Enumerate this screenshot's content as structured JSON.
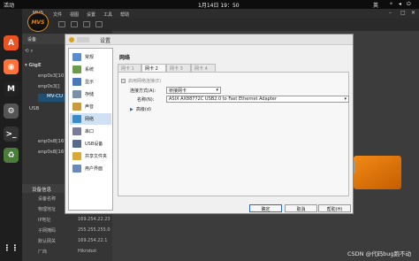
{
  "topbar": {
    "activities": "活动",
    "clock": "1月14日  19：50",
    "lang": "英",
    "tray": "⚬ ◂ ⏻"
  },
  "dock": [
    {
      "icon": "app-center-icon",
      "color": "#e95420",
      "glyph": "A"
    },
    {
      "icon": "firefox-icon",
      "color": "#ff7139",
      "glyph": "◉"
    },
    {
      "icon": "mvs-icon",
      "color": "#222222",
      "glyph": "M"
    },
    {
      "icon": "settings-icon",
      "color": "#555555",
      "glyph": "⚙"
    },
    {
      "icon": "terminal-icon",
      "color": "#333333",
      "glyph": ">_"
    },
    {
      "icon": "trash-icon",
      "color": "#4a7c3a",
      "glyph": "♻"
    },
    {
      "icon": "app-grid-icon",
      "color": "#1e1e1e",
      "glyph": "⋮⋮"
    }
  ],
  "mvs": {
    "window_title": "MVS",
    "logo": "MVS",
    "menu": [
      "文件",
      "视图",
      "设置",
      "工具",
      "帮助"
    ],
    "device_panel_header": "设备",
    "gige_label": "GigE",
    "enp0s3_1": "enp0s3[10.0",
    "enp0s3_2": "enp0s3[]",
    "device": "MV-CU",
    "usb_label": "USB",
    "enp0s8_1": "enp0s8[169",
    "enp0s8_2": "enp0s8[169",
    "devinfo_header": "设备信息",
    "devinfo": [
      {
        "k": "设备名称",
        "v": ""
      },
      {
        "k": "物理地址",
        "v": ""
      },
      {
        "k": "IP地址",
        "v": "169.254.22.23"
      },
      {
        "k": "子网掩码",
        "v": "255.255.255.0"
      },
      {
        "k": "默认网关",
        "v": "169.254.22.1"
      },
      {
        "k": "厂商",
        "v": "Hikrobot"
      }
    ]
  },
  "dialog": {
    "title": "设置",
    "categories": [
      {
        "label": "常规",
        "icon": "general-icon",
        "color": "#5a8bd0"
      },
      {
        "label": "系统",
        "icon": "system-icon",
        "color": "#6a9a4a"
      },
      {
        "label": "显示",
        "icon": "display-icon",
        "color": "#4a78b8"
      },
      {
        "label": "存储",
        "icon": "storage-icon",
        "color": "#7b8fa8"
      },
      {
        "label": "声音",
        "icon": "audio-icon",
        "color": "#c89a3a"
      },
      {
        "label": "网络",
        "icon": "network-icon",
        "color": "#3a8ac8"
      },
      {
        "label": "串口",
        "icon": "serial-port-icon",
        "color": "#7a7a9a"
      },
      {
        "label": "USB设备",
        "icon": "usb-icon",
        "color": "#5a6a8a"
      },
      {
        "label": "共享文件夹",
        "icon": "shared-folder-icon",
        "color": "#d8a838"
      },
      {
        "label": "用户界面",
        "icon": "user-interface-icon",
        "color": "#6a88b8"
      }
    ],
    "selected_category": 5,
    "pane_title": "网络",
    "tabs": [
      "网卡 1",
      "网卡 2",
      "网卡 3",
      "网卡 4"
    ],
    "active_tab": 1,
    "enable_label": "启用网络连接(E)",
    "attach_label": "连接方式(A):",
    "attach_value": "桥接网卡",
    "name_label": "名称(N):",
    "name_value": "ASIX AX88772C USB2.0 to Fast Ethernet Adapter",
    "advanced": "高级(d)",
    "buttons": {
      "ok": "确定",
      "cancel": "取消",
      "help": "帮助(H)"
    }
  },
  "watermark": "CSDN @代码bug跑不动"
}
